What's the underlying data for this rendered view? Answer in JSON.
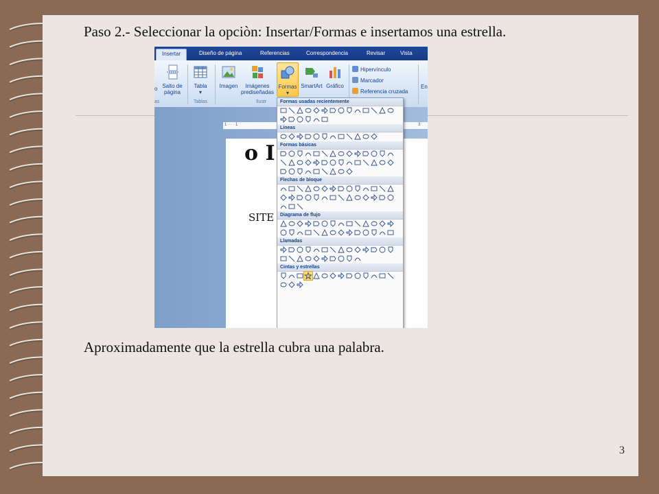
{
  "slide": {
    "title": "Paso 2.- Seleccionar la opciòn: Insertar/Formas e insertamos una estrella.",
    "caption": "Aproximadamente que la estrella cubra una palabra.",
    "page_number": "3"
  },
  "ribbon": {
    "tabs": [
      "Insertar",
      "Diseño de página",
      "Referencias",
      "Correspondencia",
      "Revisar",
      "Vista"
    ],
    "active_tab": "Insertar",
    "buttons": {
      "salto_l1": "Salto de",
      "salto_l2": "página",
      "tabla": "Tabla",
      "imagen": "Imagen",
      "imagenes_l1": "Imágenes",
      "imagenes_l2": "prediseñadas",
      "formas": "Formas",
      "smartart": "SmartArt",
      "grafico": "Gráfico",
      "hipervinculo": "Hipervínculo",
      "marcador": "Marcador",
      "referencia_cruzada": "Referencia cruzada",
      "partial_left": "co",
      "partial_right": "En"
    },
    "groups": {
      "left_partial": "as",
      "tablas": "Tablas",
      "ilustraciones_partial": "Ilustr"
    }
  },
  "document": {
    "ruler_left": "1 · · · 1",
    "ruler_right": "3",
    "big_text": "o I",
    "small_text": "SITE"
  },
  "shapes_menu": {
    "sections": [
      {
        "label": "Formas usadas recientemente",
        "rows": [
          14,
          6
        ]
      },
      {
        "label": "Líneas",
        "rows": [
          12
        ]
      },
      {
        "label": "Formas básicas",
        "rows": [
          14,
          14,
          9
        ]
      },
      {
        "label": "Flechas de bloque",
        "rows": [
          14,
          14,
          3
        ]
      },
      {
        "label": "Diagrama de flujo",
        "rows": [
          14,
          14
        ]
      },
      {
        "label": "Llamadas",
        "rows": [
          14,
          10
        ]
      },
      {
        "label": "Cintas y estrellas",
        "rows": [
          14,
          3
        ]
      }
    ],
    "highlighted": "star-5-point"
  }
}
